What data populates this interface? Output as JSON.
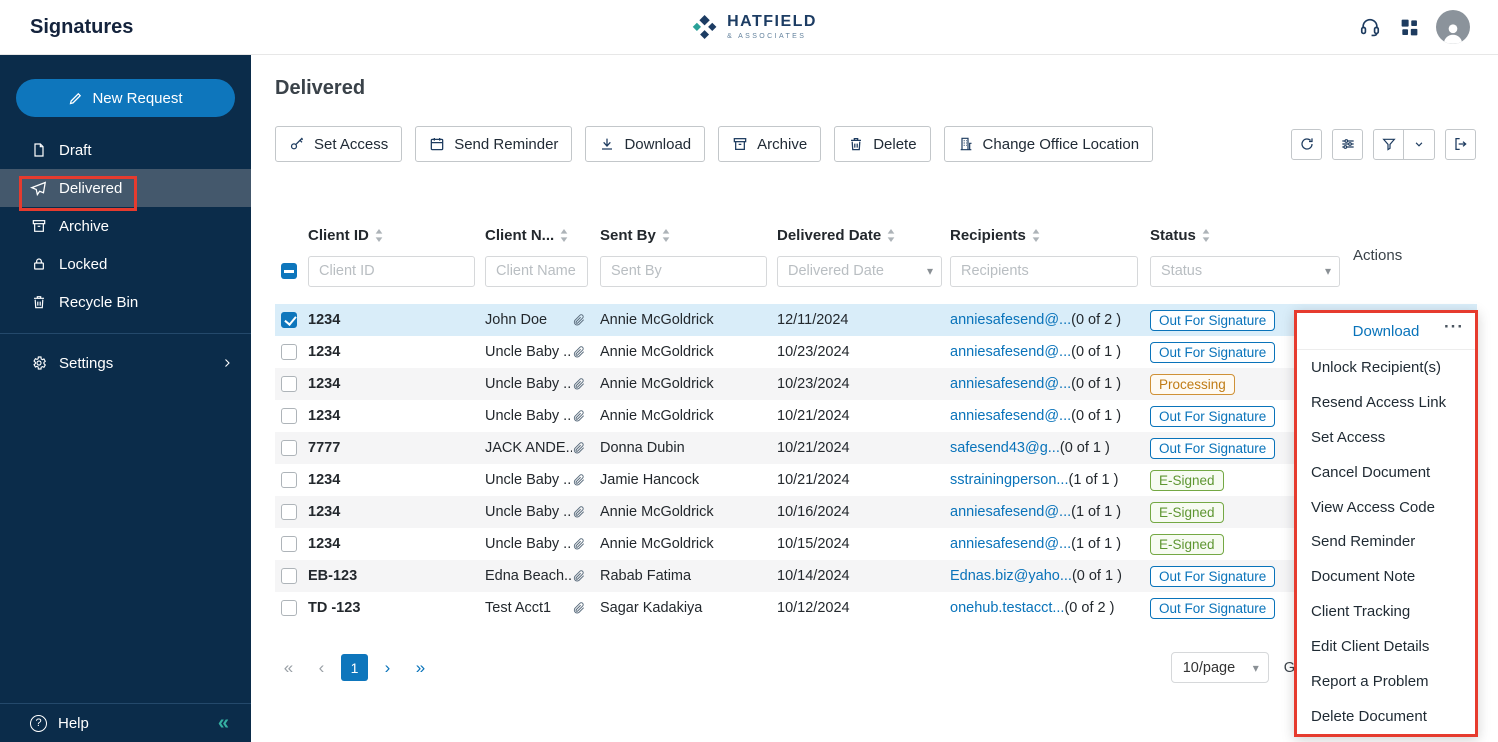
{
  "colors": {
    "sidebar_bg": "#0b2c4a",
    "accent_blue": "#0973ba",
    "selected_row_bg": "#d9edf9",
    "annotation_red": "#e63b2e",
    "status_blue": "#0973ba",
    "status_orange": "#c07c16",
    "status_green": "#5e9631",
    "collapse_teal": "#35b0a2"
  },
  "icons": {
    "caret_down": "▾",
    "more": "···",
    "collapse": "«",
    "pager_first": "«",
    "pager_prev": "‹",
    "pager_next": "›",
    "pager_last": "»",
    "help_glyph": "?"
  },
  "topbar": {
    "title": "Signatures",
    "brand_name": "HATFIELD",
    "brand_tagline": "& ASSOCIATES"
  },
  "sidebar": {
    "new_request_label": "New Request",
    "items": [
      {
        "label": "Draft",
        "icon": "draft-icon"
      },
      {
        "label": "Delivered",
        "icon": "delivered-icon",
        "selected": true,
        "annotated": true
      },
      {
        "label": "Archive",
        "icon": "archive-icon"
      },
      {
        "label": "Locked",
        "icon": "lock-icon"
      },
      {
        "label": "Recycle Bin",
        "icon": "trash-icon"
      }
    ],
    "settings_label": "Settings",
    "help_label": "Help"
  },
  "page": {
    "title": "Delivered"
  },
  "toolbar": {
    "set_access": "Set Access",
    "send_reminder": "Send Reminder",
    "download": "Download",
    "archive": "Archive",
    "delete": "Delete",
    "change_office_location": "Change Office Location"
  },
  "table": {
    "headers": {
      "client_id": "Client ID",
      "client_name": "Client N...",
      "sent_by": "Sent By",
      "delivered_date": "Delivered Date",
      "recipients": "Recipients",
      "status": "Status",
      "actions": "Actions"
    },
    "filters": {
      "client_id": "Client ID",
      "client_name": "Client Name",
      "sent_by": "Sent By",
      "delivered_date": "Delivered Date",
      "recipients": "Recipients",
      "status": "Status"
    },
    "rows": [
      {
        "checked": true,
        "selected": true,
        "client_id": "1234",
        "client_name": "John Doe",
        "sent_by": "Annie McGoldrick",
        "delivered_date": "12/11/2024",
        "recipient": "anniesafesend@...",
        "recipient_count": "(0 of 2 )",
        "status": "Out For Signature",
        "status_type": "out"
      },
      {
        "client_id": "1234",
        "client_name": "Uncle Baby ...",
        "sent_by": "Annie McGoldrick",
        "delivered_date": "10/23/2024",
        "recipient": "anniesafesend@...",
        "recipient_count": "(0 of 1 )",
        "status": "Out For Signature",
        "status_type": "out"
      },
      {
        "client_id": "1234",
        "client_name": "Uncle Baby ...",
        "sent_by": "Annie McGoldrick",
        "delivered_date": "10/23/2024",
        "recipient": "anniesafesend@...",
        "recipient_count": "(0 of 1 )",
        "status": "Processing",
        "status_type": "processing"
      },
      {
        "client_id": "1234",
        "client_name": "Uncle Baby ...",
        "sent_by": "Annie McGoldrick",
        "delivered_date": "10/21/2024",
        "recipient": "anniesafesend@...",
        "recipient_count": "(0 of 1 )",
        "status": "Out For Signature",
        "status_type": "out"
      },
      {
        "client_id": "7777",
        "client_name": "JACK ANDE...",
        "sent_by": "Donna Dubin",
        "delivered_date": "10/21/2024",
        "recipient": "safesend43@g...",
        "recipient_count": "(0 of 1 )",
        "status": "Out For Signature",
        "status_type": "out"
      },
      {
        "client_id": "1234",
        "client_name": "Uncle Baby ...",
        "sent_by": "Jamie Hancock",
        "delivered_date": "10/21/2024",
        "recipient": "sstrainingperson...",
        "recipient_count": "(1 of 1 )",
        "status": "E-Signed",
        "status_type": "signed"
      },
      {
        "client_id": "1234",
        "client_name": "Uncle Baby ...",
        "sent_by": "Annie McGoldrick",
        "delivered_date": "10/16/2024",
        "recipient": "anniesafesend@...",
        "recipient_count": "(1 of 1 )",
        "status": "E-Signed",
        "status_type": "signed"
      },
      {
        "client_id": "1234",
        "client_name": "Uncle Baby ...",
        "sent_by": "Annie McGoldrick",
        "delivered_date": "10/15/2024",
        "recipient": "anniesafesend@...",
        "recipient_count": "(1 of 1 )",
        "status": "E-Signed",
        "status_type": "signed"
      },
      {
        "client_id": "EB-123",
        "client_name": "Edna Beach...",
        "sent_by": "Rabab Fatima",
        "delivered_date": "10/14/2024",
        "recipient": "Ednas.biz@yaho...",
        "recipient_count": "(0 of 1 )",
        "status": "Out For Signature",
        "status_type": "out"
      },
      {
        "client_id": "TD -123",
        "client_name": "Test Acct1",
        "sent_by": "Sagar Kadakiya",
        "delivered_date": "10/12/2024",
        "recipient": "onehub.testacct...",
        "recipient_count": "(0 of 2 )",
        "status": "Out For Signature",
        "status_type": "out"
      }
    ]
  },
  "actions_menu": {
    "primary_action": "Download",
    "items": [
      "Unlock Recipient(s)",
      "Resend Access Link",
      "Set Access",
      "Cancel Document",
      "View Access Code",
      "Send Reminder",
      "Document Note",
      "Client Tracking",
      "Edit Client Details",
      "Report a Problem",
      "Delete Document"
    ]
  },
  "pagination": {
    "page": "1",
    "page_size": "10/page",
    "goto_label": "G"
  }
}
